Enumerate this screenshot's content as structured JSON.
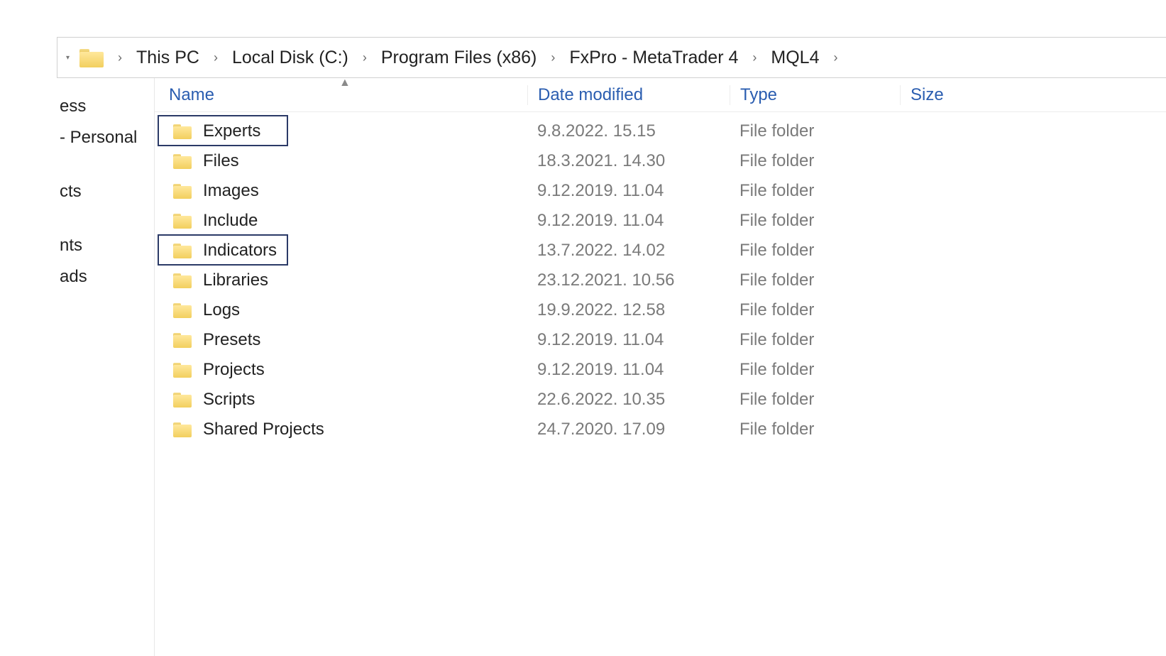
{
  "breadcrumb": {
    "items": [
      "This PC",
      "Local Disk (C:)",
      "Program Files (x86)",
      "FxPro - MetaTrader 4",
      "MQL4"
    ]
  },
  "nav": {
    "items": [
      "ess",
      " - Personal",
      "cts",
      "nts",
      "ads"
    ]
  },
  "columns": {
    "name": "Name",
    "date": "Date modified",
    "type": "Type",
    "size": "Size"
  },
  "files": [
    {
      "name": "Experts",
      "date": "9.8.2022. 15.15",
      "type": "File folder",
      "size": ""
    },
    {
      "name": "Files",
      "date": "18.3.2021. 14.30",
      "type": "File folder",
      "size": ""
    },
    {
      "name": "Images",
      "date": "9.12.2019. 11.04",
      "type": "File folder",
      "size": ""
    },
    {
      "name": "Include",
      "date": "9.12.2019. 11.04",
      "type": "File folder",
      "size": ""
    },
    {
      "name": "Indicators",
      "date": "13.7.2022. 14.02",
      "type": "File folder",
      "size": ""
    },
    {
      "name": "Libraries",
      "date": "23.12.2021. 10.56",
      "type": "File folder",
      "size": ""
    },
    {
      "name": "Logs",
      "date": "19.9.2022. 12.58",
      "type": "File folder",
      "size": ""
    },
    {
      "name": "Presets",
      "date": "9.12.2019. 11.04",
      "type": "File folder",
      "size": ""
    },
    {
      "name": "Projects",
      "date": "9.12.2019. 11.04",
      "type": "File folder",
      "size": ""
    },
    {
      "name": "Scripts",
      "date": "22.6.2022. 10.35",
      "type": "File folder",
      "size": ""
    },
    {
      "name": "Shared Projects",
      "date": "24.7.2020. 17.09",
      "type": "File folder",
      "size": ""
    }
  ]
}
